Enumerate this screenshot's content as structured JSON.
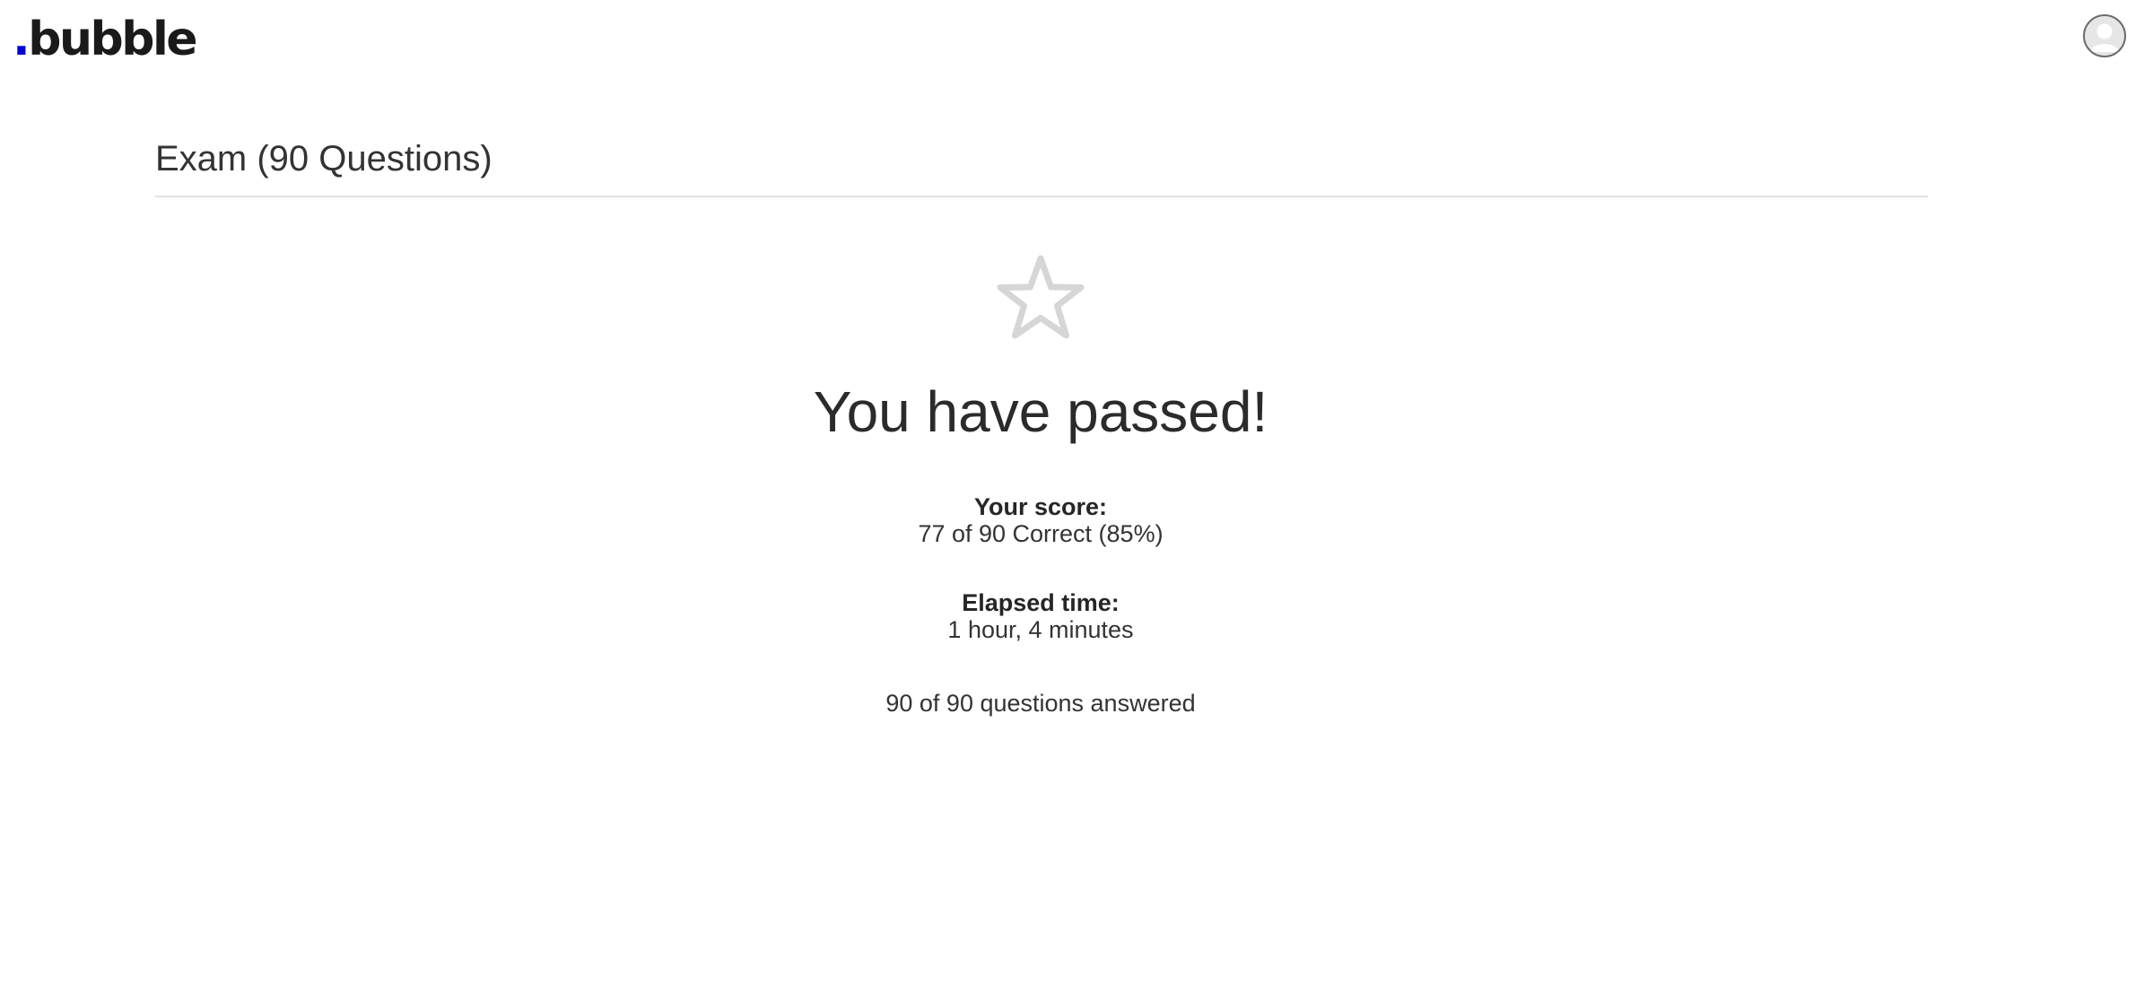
{
  "header": {
    "logo_dot": ".",
    "logo_text": "bubble",
    "brand_color": "#0205d3",
    "avatar_icon": "user-avatar-icon"
  },
  "exam": {
    "title": "Exam (90 Questions)"
  },
  "result": {
    "icon": "star-outline-icon",
    "icon_color": "#d6d6d6",
    "title": "You have passed!",
    "score_label": "Your score:",
    "score_value": "77 of 90 Correct (85%)",
    "time_label": "Elapsed time:",
    "time_value": "1 hour, 4 minutes",
    "answered_text": "90 of 90 questions answered"
  }
}
